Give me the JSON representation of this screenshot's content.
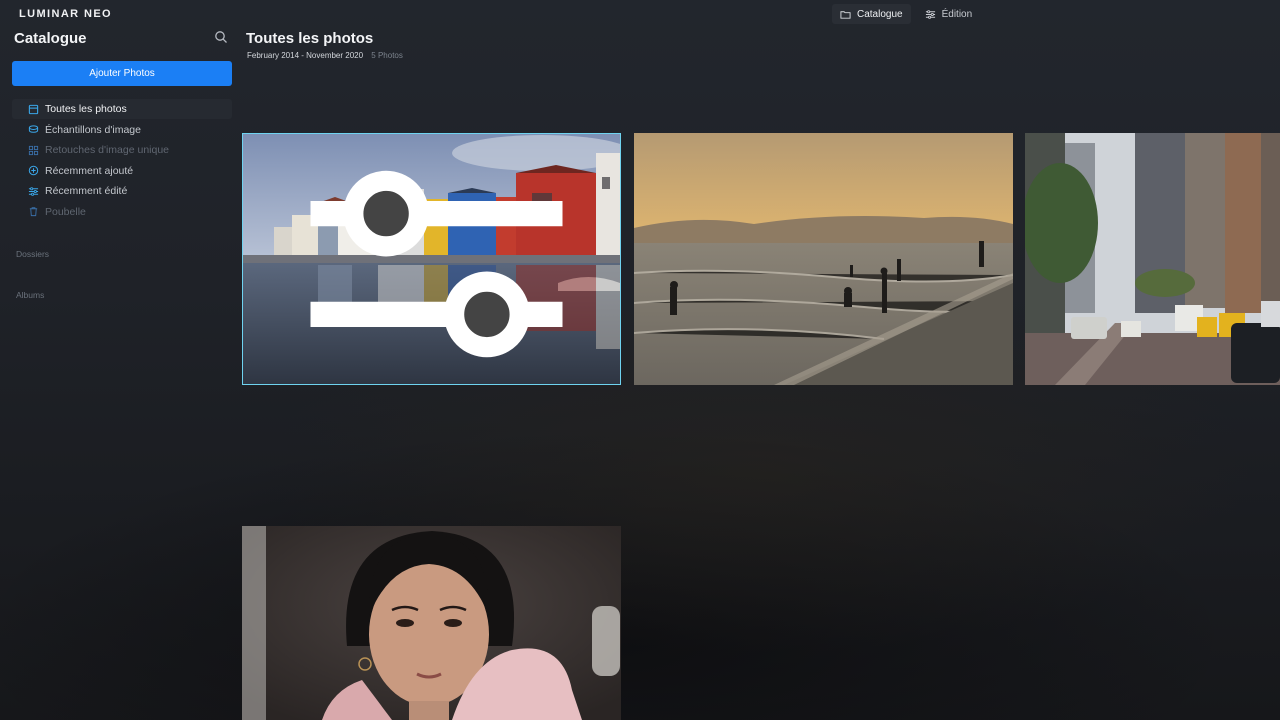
{
  "app": {
    "logo_text": "LUMINAR NEO"
  },
  "top_modes": [
    {
      "label": "Catalogue",
      "icon": "folder-icon",
      "active": true
    },
    {
      "label": "Édition",
      "icon": "sliders-icon",
      "active": false
    }
  ],
  "sidebar": {
    "title": "Catalogue",
    "add_button": "Ajouter Photos",
    "items": [
      {
        "label": "Toutes les photos",
        "icon": "photos-icon",
        "active": true
      },
      {
        "label": "Échantillons d'image",
        "icon": "samples-icon"
      },
      {
        "label": "Retouches d'image unique",
        "icon": "grid-icon",
        "dim": true
      },
      {
        "label": "Récemment ajouté",
        "icon": "plus-circle-icon"
      },
      {
        "label": "Récemment édité",
        "icon": "sliders-icon"
      },
      {
        "label": "Poubelle",
        "icon": "trash-icon",
        "dim": true
      }
    ],
    "sections": {
      "folders": "Dossiers",
      "albums": "Albums"
    }
  },
  "main": {
    "title": "Toutes les photos",
    "date_range": "February 2014 - November 2020",
    "photo_count": "5 Photos"
  },
  "colors": {
    "accent": "#1b7ff5",
    "selection": "#6fd3f0",
    "icon_blue": "#3aa6e8"
  }
}
